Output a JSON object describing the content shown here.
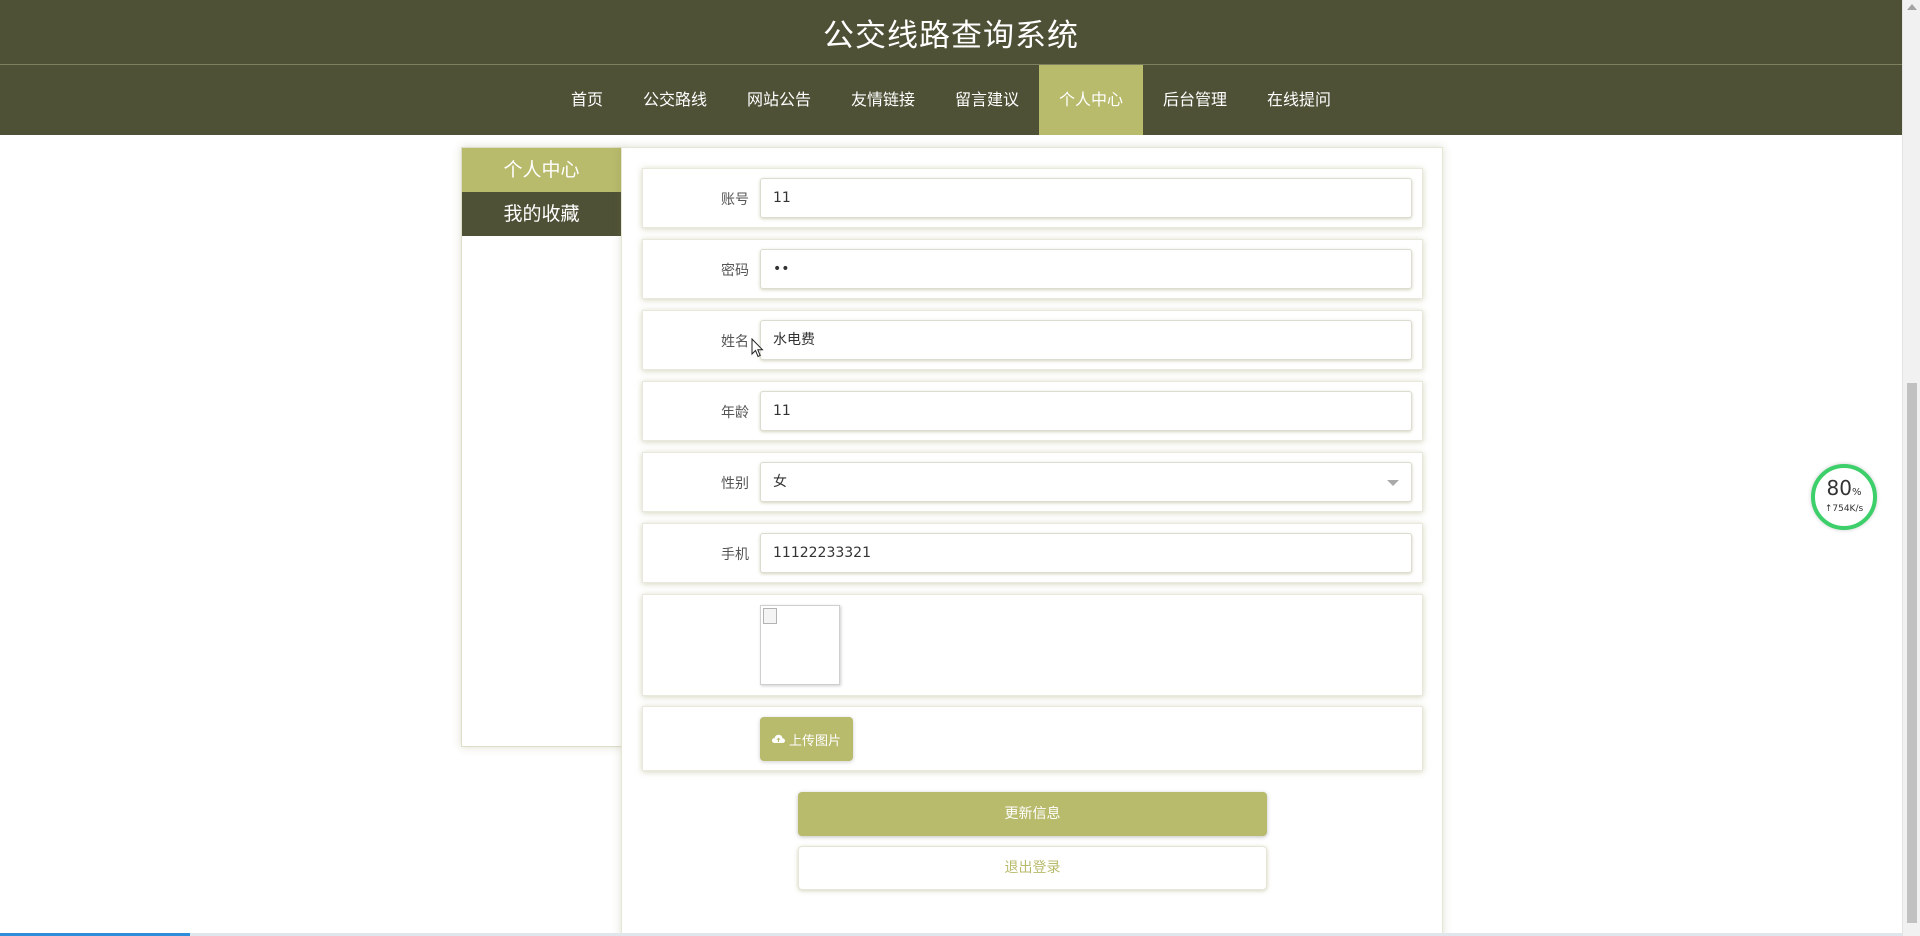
{
  "header": {
    "title": "公交线路查询系统"
  },
  "nav": {
    "items": [
      {
        "label": "首页",
        "active": false
      },
      {
        "label": "公交路线",
        "active": false
      },
      {
        "label": "网站公告",
        "active": false
      },
      {
        "label": "友情链接",
        "active": false
      },
      {
        "label": "留言建议",
        "active": false
      },
      {
        "label": "个人中心",
        "active": true
      },
      {
        "label": "后台管理",
        "active": false
      },
      {
        "label": "在线提问",
        "active": false
      }
    ]
  },
  "sidebar": {
    "items": [
      {
        "label": "个人中心",
        "active": true
      },
      {
        "label": "我的收藏",
        "active": false
      }
    ]
  },
  "form": {
    "account": {
      "label": "账号",
      "value": "11"
    },
    "password": {
      "label": "密码",
      "value": "••"
    },
    "name": {
      "label": "姓名",
      "value": "水电费"
    },
    "age": {
      "label": "年龄",
      "value": "11"
    },
    "gender": {
      "label": "性别",
      "value": "女"
    },
    "phone": {
      "label": "手机",
      "value": "11122233321"
    },
    "upload_label": "上传图片"
  },
  "actions": {
    "update_label": "更新信息",
    "logout_label": "退出登录"
  },
  "speed_widget": {
    "percent": "80",
    "percent_unit": "%",
    "rate": "↑754K/s",
    "ring_color": "#3ccf6a"
  },
  "colors": {
    "header_bg": "#4e5136",
    "accent": "#b8ba6c"
  }
}
